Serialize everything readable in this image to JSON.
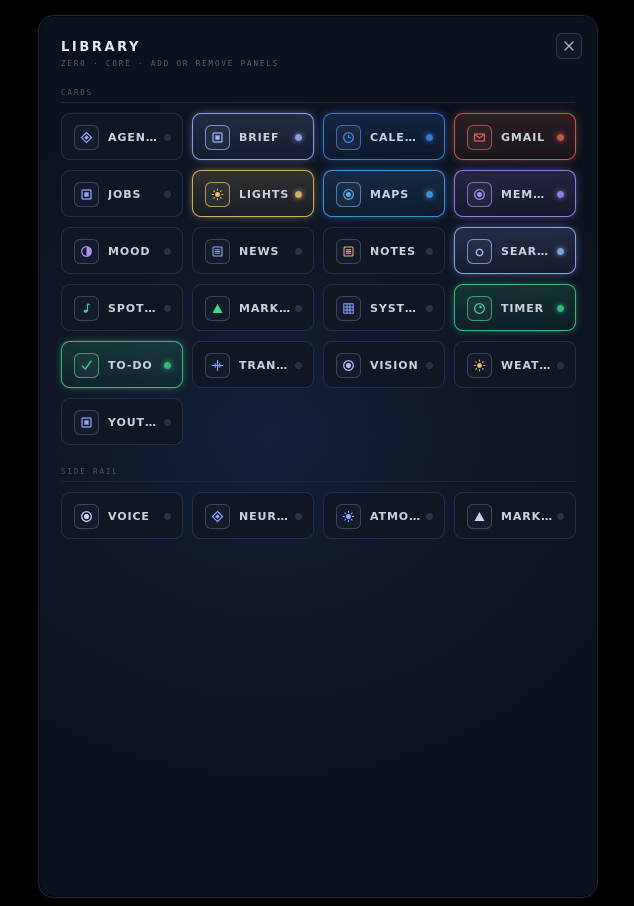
{
  "header": {
    "title": "LIBRARY",
    "subtitle": "ZERO · CORE · ADD OR REMOVE PANELS",
    "close_icon": "close-icon"
  },
  "sections": [
    {
      "label": "CARDS",
      "tiles": [
        {
          "label": "AGENTS",
          "icon": "diamond-icon",
          "active": false,
          "color": "#8ea8ff"
        },
        {
          "label": "BRIEF",
          "icon": "square-icon",
          "active": true,
          "color": "#9bb9ff"
        },
        {
          "label": "CALENDAR",
          "icon": "clock-icon",
          "active": true,
          "color": "#3d8bf0"
        },
        {
          "label": "GMAIL",
          "icon": "mail-icon",
          "active": true,
          "color": "#e3624c"
        },
        {
          "label": "JOBS",
          "icon": "square-icon",
          "active": false,
          "color": "#8ea8ff"
        },
        {
          "label": "LIGHTS",
          "icon": "sun-icon",
          "active": true,
          "color": "#f0c46a"
        },
        {
          "label": "MAPS",
          "icon": "circle-dot-icon",
          "active": true,
          "color": "#4aa6ef"
        },
        {
          "label": "MEMORY",
          "icon": "circle-dot-icon",
          "active": true,
          "color": "#a48cf2"
        },
        {
          "label": "MOOD",
          "icon": "half-circle-icon",
          "active": false,
          "color": "#b58cf2"
        },
        {
          "label": "NEWS",
          "icon": "list-icon",
          "active": false,
          "color": "#8ea8ff"
        },
        {
          "label": "NOTES",
          "icon": "notes-icon",
          "active": false,
          "color": "#e7b15a"
        },
        {
          "label": "SEARCH",
          "icon": "ring-icon",
          "active": true,
          "color": "#9bb9ff"
        },
        {
          "label": "SPOTIFY",
          "icon": "music-note-icon",
          "active": false,
          "color": "#3fcf8a"
        },
        {
          "label": "MARKETS",
          "icon": "triangle-icon",
          "active": false,
          "color": "#3fdc8e"
        },
        {
          "label": "SYSTEM",
          "icon": "grid-icon",
          "active": false,
          "color": "#8ea8ff"
        },
        {
          "label": "TIMER",
          "icon": "timer-icon",
          "active": true,
          "color": "#3fcf8a"
        },
        {
          "label": "TO-DO",
          "icon": "check-icon",
          "active": true,
          "color": "#3fcf8a"
        },
        {
          "label": "TRANSIT",
          "icon": "crosshair-icon",
          "active": false,
          "color": "#8ea8ff"
        },
        {
          "label": "VISION",
          "icon": "circle-dot-icon",
          "active": false,
          "color": "#b0b8ff"
        },
        {
          "label": "WEATHER",
          "icon": "sun-icon",
          "active": false,
          "color": "#f0c46a"
        },
        {
          "label": "YOUTUBE",
          "icon": "square-icon",
          "active": false,
          "color": "#8ea8ff"
        }
      ]
    },
    {
      "label": "SIDE RAIL",
      "tiles": [
        {
          "label": "VOICE",
          "icon": "circle-dot-icon",
          "active": false,
          "color": "#c7d2ff"
        },
        {
          "label": "NEURAL",
          "icon": "diamond-icon",
          "active": false,
          "color": "#8ea8ff"
        },
        {
          "label": "ATMOSPHERE",
          "icon": "starburst-icon",
          "active": false,
          "color": "#8ea8ff"
        },
        {
          "label": "MARKETS",
          "icon": "triangle-icon",
          "active": false,
          "color": "#c7d2ff"
        }
      ]
    }
  ]
}
